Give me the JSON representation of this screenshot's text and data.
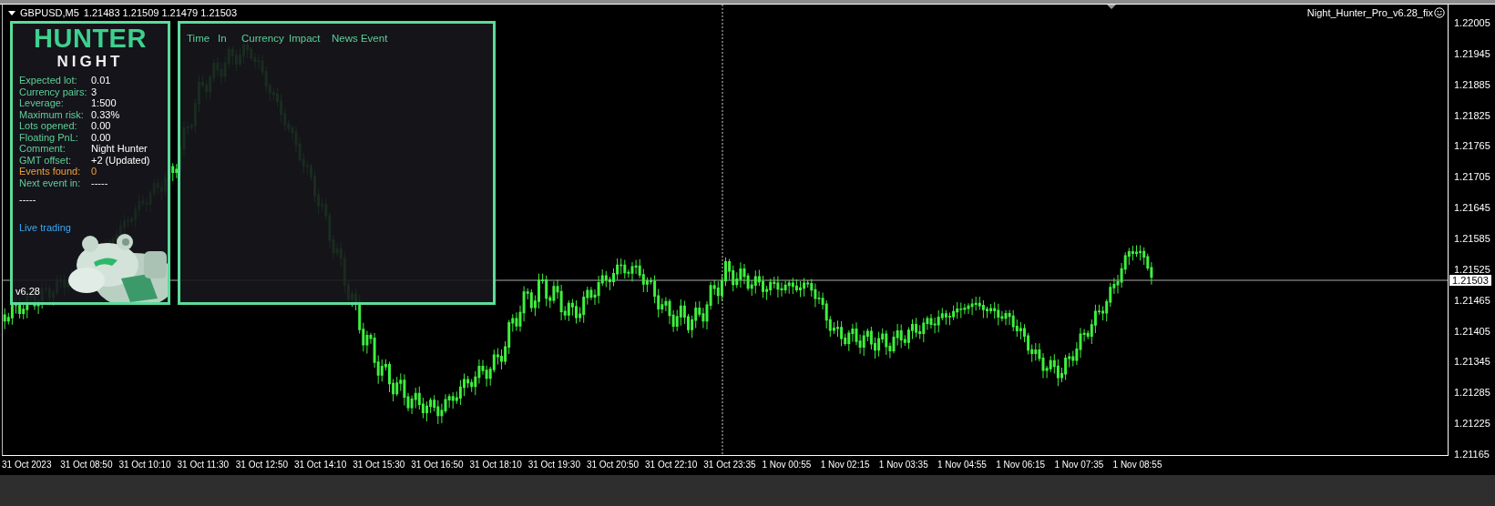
{
  "chart_header": {
    "symbol": "GBPUSD,M5",
    "ohlc": "1.21483 1.21509 1.21479 1.21503"
  },
  "expert": {
    "name": "Night_Hunter_Pro_v6.28_fix"
  },
  "info_panel": {
    "logo_top": "HUNTER",
    "logo_bottom": "NIGHT",
    "rows": [
      {
        "label": "Expected lot:",
        "value": "0.01",
        "kind": "normal"
      },
      {
        "label": "Currency pairs:",
        "value": "3",
        "kind": "normal"
      },
      {
        "label": "Leverage:",
        "value": "1:500",
        "kind": "normal"
      },
      {
        "label": "Maximum risk:",
        "value": "0.33%",
        "kind": "normal"
      },
      {
        "label": "Lots opened:",
        "value": "0.00",
        "kind": "normal"
      },
      {
        "label": "Floating PnL:",
        "value": "0.00",
        "kind": "normal"
      },
      {
        "label": "Comment:",
        "value": "Night Hunter",
        "kind": "normal"
      },
      {
        "label": "GMT offset:",
        "value": "+2 (Updated)",
        "kind": "normal"
      },
      {
        "label": "Events found:",
        "value": "0",
        "kind": "alert"
      },
      {
        "label": "Next event in:",
        "value": "-----",
        "kind": "normal"
      }
    ],
    "separator": "-----",
    "status": "Live trading",
    "version": "v6.28"
  },
  "news_panel": {
    "columns": [
      "Time",
      "In",
      "Currency",
      "Impact",
      "News Event"
    ]
  },
  "price_axis": {
    "labels": [
      "1.22005",
      "1.21945",
      "1.21885",
      "1.21825",
      "1.21765",
      "1.21705",
      "1.21645",
      "1.21585",
      "1.21525",
      "1.21465",
      "1.21405",
      "1.21345",
      "1.21285",
      "1.21225",
      "1.21165"
    ],
    "current_price": "1.21503"
  },
  "time_axis": {
    "labels": [
      "31 Oct 2023",
      "31 Oct 08:50",
      "31 Oct 10:10",
      "31 Oct 11:30",
      "31 Oct 12:50",
      "31 Oct 14:10",
      "31 Oct 15:30",
      "31 Oct 16:50",
      "31 Oct 18:10",
      "31 Oct 19:30",
      "31 Oct 20:50",
      "31 Oct 22:10",
      "31 Oct 23:35",
      "1 Nov 00:55",
      "1 Nov 02:15",
      "1 Nov 03:35",
      "1 Nov 04:55",
      "1 Nov 06:15",
      "1 Nov 07:35",
      "1 Nov 08:55"
    ]
  }
}
